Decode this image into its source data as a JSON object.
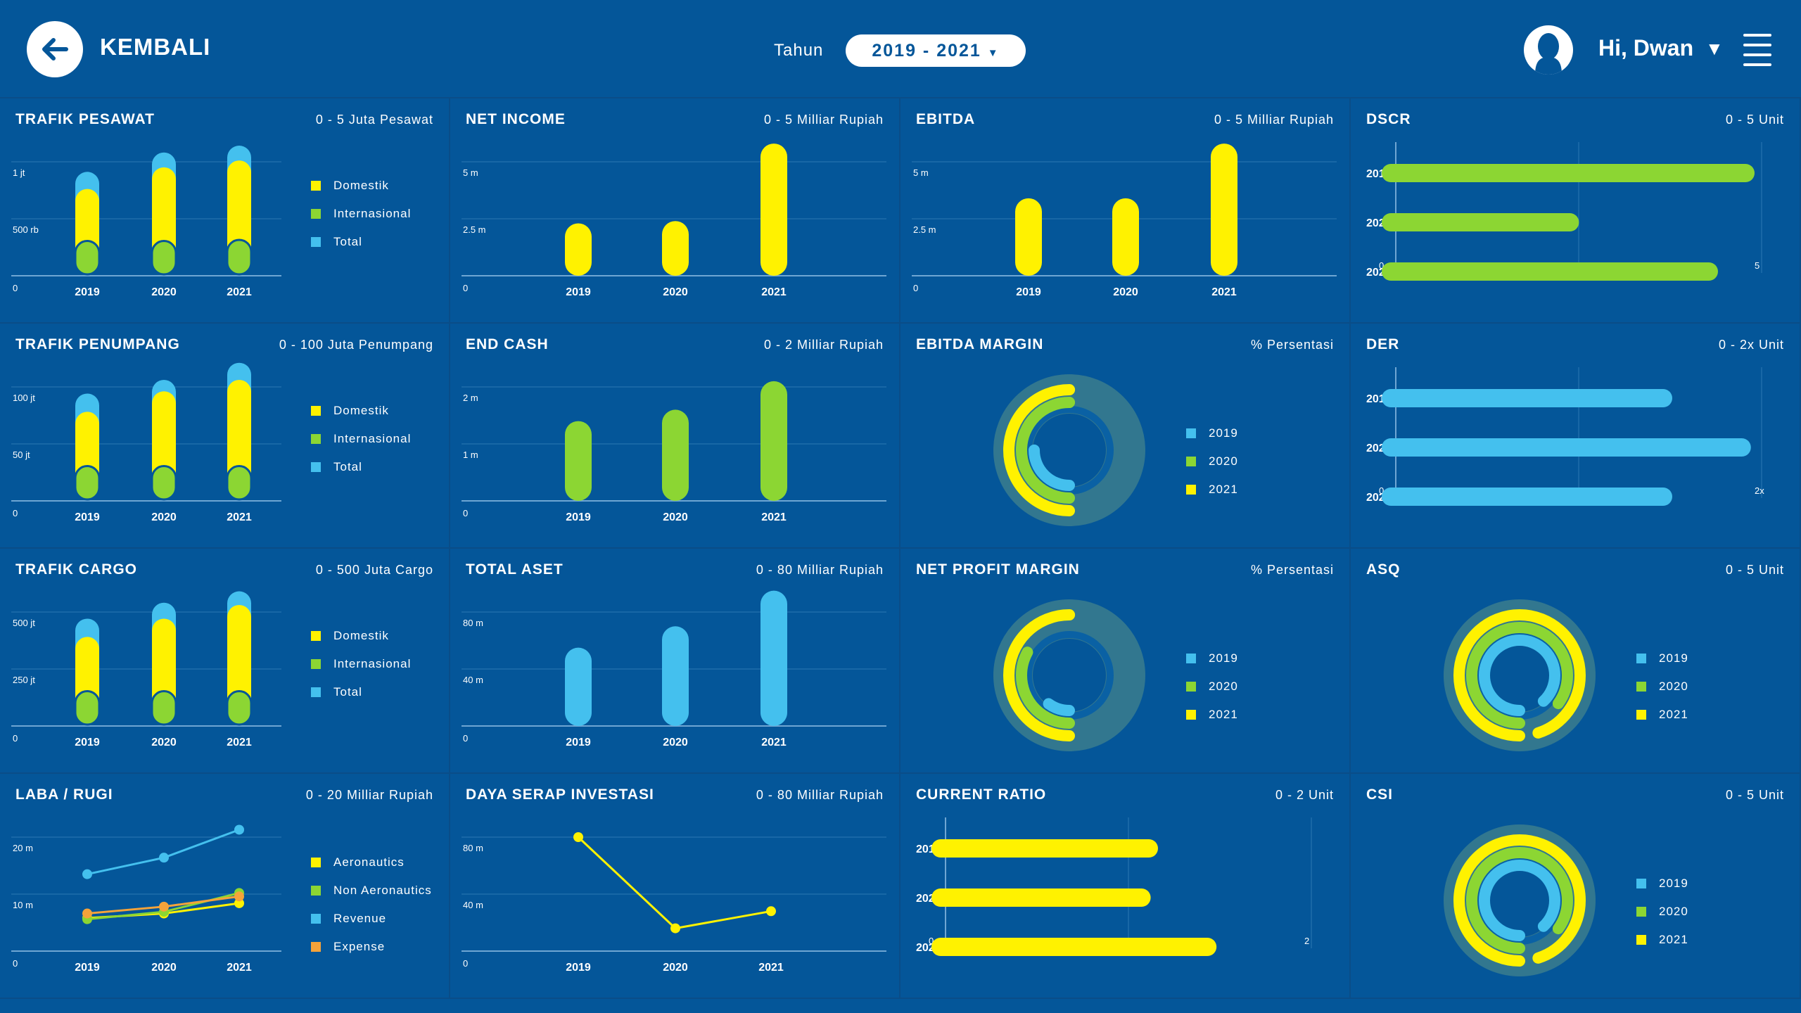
{
  "header": {
    "back_label": "KEMBALI",
    "year_label": "Tahun",
    "year_value": "2019 - 2021",
    "greeting": "Hi, Dwan"
  },
  "colors": {
    "background": "#045699",
    "yellow": "#fff200",
    "green": "#8cd633",
    "blue": "#44c0ee",
    "orange": "#f5a33a"
  },
  "years": [
    "2019",
    "2020",
    "2021"
  ],
  "legends": {
    "traffic": [
      "Domestik",
      "Internasional",
      "Total"
    ],
    "margin": [
      "2019",
      "2020",
      "2021"
    ],
    "laba": [
      "Aeronautics",
      "Non Aeronautics",
      "Revenue",
      "Expense"
    ]
  },
  "chart_data": [
    {
      "id": "trafik-pesawat",
      "type": "bar",
      "title": "TRAFIK PESAWAT",
      "range": "0 - 5 Juta Pesawat",
      "categories": [
        "2019",
        "2020",
        "2021"
      ],
      "yticks": [
        "0",
        "500 rb",
        "1 jt"
      ],
      "ylim": [
        0,
        1000000
      ],
      "series": [
        {
          "name": "Domestik",
          "values": [
            700000,
            890000,
            950000
          ]
        },
        {
          "name": "Internasional",
          "values": [
            120000,
            120000,
            130000
          ]
        },
        {
          "name": "Total",
          "values": [
            850000,
            1020000,
            1080000
          ]
        }
      ]
    },
    {
      "id": "net-income",
      "type": "bar",
      "title": "NET INCOME",
      "range": "0 - 5 Milliar Rupiah",
      "categories": [
        "2019",
        "2020",
        "2021"
      ],
      "yticks": [
        "0",
        "2.5 m",
        "5 m"
      ],
      "ylim": [
        0,
        5
      ],
      "series": [
        {
          "values": [
            2.3,
            2.4,
            5.8
          ]
        }
      ]
    },
    {
      "id": "ebitda",
      "type": "bar",
      "title": "EBITDA",
      "range": "0 - 5 Milliar Rupiah",
      "categories": [
        "2019",
        "2020",
        "2021"
      ],
      "yticks": [
        "0",
        "2.5 m",
        "5 m"
      ],
      "ylim": [
        0,
        5
      ],
      "series": [
        {
          "values": [
            3.4,
            3.4,
            5.8
          ]
        }
      ]
    },
    {
      "id": "dscr",
      "type": "hbar",
      "title": "DSCR",
      "range": "0 - 5 Unit",
      "categories": [
        "2019",
        "2020",
        "2021"
      ],
      "xticks": [
        "0",
        "2.5",
        "5"
      ],
      "xlim": [
        0,
        5
      ],
      "series": [
        {
          "values": [
            5,
            2.6,
            4.5
          ]
        }
      ]
    },
    {
      "id": "trafik-penumpang",
      "type": "bar",
      "title": "TRAFIK PENUMPANG",
      "range": "0 - 100 Juta Penumpang",
      "categories": [
        "2019",
        "2020",
        "2021"
      ],
      "yticks": [
        "0",
        "50 jt",
        "100 jt"
      ],
      "ylim": [
        0,
        100
      ],
      "series": [
        {
          "name": "Domestik",
          "values": [
            72,
            90,
            100
          ]
        },
        {
          "name": "Internasional",
          "values": [
            12,
            12,
            12
          ]
        },
        {
          "name": "Total",
          "values": [
            88,
            100,
            115
          ]
        }
      ]
    },
    {
      "id": "end-cash",
      "type": "bar",
      "title": "END CASH",
      "range": "0 - 2 Milliar Rupiah",
      "categories": [
        "2019",
        "2020",
        "2021"
      ],
      "yticks": [
        "0",
        "1 m",
        "2 m"
      ],
      "ylim": [
        0,
        2
      ],
      "series": [
        {
          "values": [
            1.4,
            1.6,
            2.1
          ]
        }
      ]
    },
    {
      "id": "ebitda-margin",
      "type": "donut",
      "title": "EBITDA MARGIN",
      "range": "% Persentasi",
      "categories": [
        "2019",
        "2020",
        "2021"
      ],
      "series": [
        {
          "values": [
            25,
            50,
            50
          ]
        }
      ]
    },
    {
      "id": "der",
      "type": "hbar",
      "title": "DER",
      "range": "0 - 2x Unit",
      "categories": [
        "2019",
        "2020",
        "2021"
      ],
      "xticks": [
        "0",
        "1x",
        "2x"
      ],
      "xlim": [
        0,
        2
      ],
      "series": [
        {
          "values": [
            1.55,
            1.98,
            1.55
          ]
        }
      ]
    },
    {
      "id": "trafik-cargo",
      "type": "bar",
      "title": "TRAFIK CARGO",
      "range": "0 - 500 Juta Cargo",
      "categories": [
        "2019",
        "2020",
        "2021"
      ],
      "yticks": [
        "0",
        "250 jt",
        "500 jt"
      ],
      "ylim": [
        0,
        500
      ],
      "series": [
        {
          "name": "Domestik",
          "values": [
            360,
            440,
            500
          ]
        },
        {
          "name": "Internasional",
          "values": [
            60,
            60,
            60
          ]
        },
        {
          "name": "Total",
          "values": [
            440,
            510,
            560
          ]
        }
      ]
    },
    {
      "id": "total-aset",
      "type": "bar",
      "title": "TOTAL ASET",
      "range": "0 - 80 Milliar Rupiah",
      "categories": [
        "2019",
        "2020",
        "2021"
      ],
      "yticks": [
        "0",
        "40 m",
        "80 m"
      ],
      "ylim": [
        0,
        80
      ],
      "series": [
        {
          "values": [
            55,
            70,
            95
          ]
        }
      ]
    },
    {
      "id": "net-profit-margin",
      "type": "donut",
      "title": "NET PROFIT MARGIN",
      "range": "% Persentasi",
      "categories": [
        "2019",
        "2020",
        "2021"
      ],
      "series": [
        {
          "values": [
            10,
            33,
            50
          ]
        }
      ]
    },
    {
      "id": "asq",
      "type": "donut",
      "title": "ASQ",
      "range": "0 - 5 Unit",
      "categories": [
        "2019",
        "2020",
        "2021"
      ],
      "series": [
        {
          "values": [
            88,
            85,
            95
          ]
        }
      ]
    },
    {
      "id": "laba-rugi",
      "type": "line",
      "title": "LABA / RUGI",
      "range": "0 - 20 Milliar Rupiah",
      "categories": [
        "2019",
        "2020",
        "2021"
      ],
      "yticks": [
        "0",
        "10 m",
        "20 m"
      ],
      "ylim": [
        0,
        20
      ],
      "series": [
        {
          "name": "Aeronautics",
          "values": [
            5.8,
            6.6,
            8.4
          ]
        },
        {
          "name": "Non Aeronautics",
          "values": [
            5.6,
            6.9,
            10.2
          ]
        },
        {
          "name": "Revenue",
          "values": [
            13.5,
            16.4,
            21.3
          ]
        },
        {
          "name": "Expense",
          "values": [
            6.6,
            7.8,
            9.6
          ]
        }
      ]
    },
    {
      "id": "daya-serap-investasi",
      "type": "line",
      "title": "DAYA SERAP INVESTASI",
      "range": "0 - 80 Milliar Rupiah",
      "categories": [
        "2019",
        "2020",
        "2021"
      ],
      "yticks": [
        "0",
        "40 m",
        "80 m"
      ],
      "ylim": [
        0,
        80
      ],
      "series": [
        {
          "values": [
            80,
            16,
            28
          ]
        }
      ]
    },
    {
      "id": "current-ratio",
      "type": "hbar",
      "title": "CURRENT RATIO",
      "range": "0 - 2 Unit",
      "categories": [
        "2019",
        "2020",
        "2021"
      ],
      "xticks": [
        "0",
        "1",
        "2"
      ],
      "xlim": [
        0,
        2
      ],
      "series": [
        {
          "values": [
            1.2,
            1.16,
            1.52
          ]
        }
      ]
    },
    {
      "id": "csi",
      "type": "donut",
      "title": "CSI",
      "range": "0 - 5 Unit",
      "categories": [
        "2019",
        "2020",
        "2021"
      ],
      "series": [
        {
          "values": [
            88,
            85,
            95
          ]
        }
      ]
    }
  ]
}
